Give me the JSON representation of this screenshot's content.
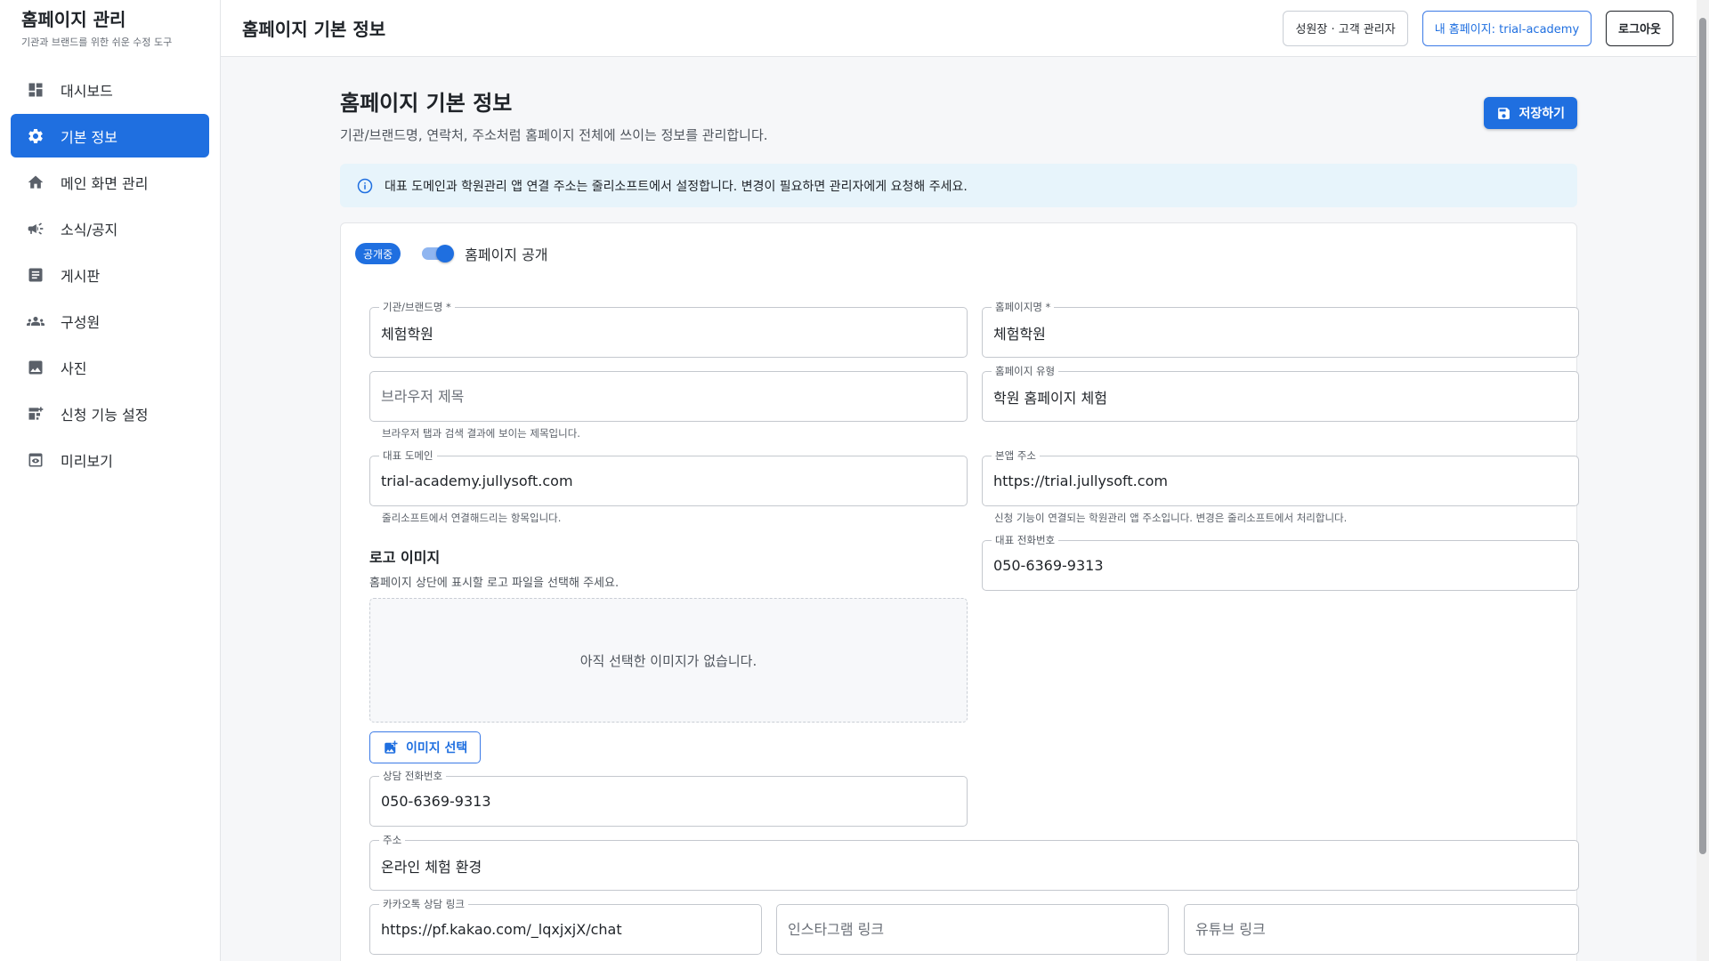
{
  "app": {
    "title": "홈페이지 관리",
    "subtitle": "기관과 브랜드를 위한 쉬운 수정 도구"
  },
  "sidebar": {
    "items": [
      {
        "label": "대시보드",
        "icon": "dashboard-icon"
      },
      {
        "label": "기본 정보",
        "icon": "gear-icon",
        "active": true
      },
      {
        "label": "메인 화면 관리",
        "icon": "home-icon"
      },
      {
        "label": "소식/공지",
        "icon": "megaphone-icon"
      },
      {
        "label": "게시판",
        "icon": "board-icon"
      },
      {
        "label": "구성원",
        "icon": "group-icon"
      },
      {
        "label": "사진",
        "icon": "image-icon"
      },
      {
        "label": "신청 기능 설정",
        "icon": "application-icon"
      },
      {
        "label": "미리보기",
        "icon": "preview-icon"
      }
    ]
  },
  "header": {
    "title": "홈페이지 기본 정보",
    "user_label": "성원장 · 고객 관리자",
    "site_label": "내 홈페이지: trial-academy",
    "logout_label": "로그아웃"
  },
  "page": {
    "title": "홈페이지 기본 정보",
    "description": "기관/브랜드명, 연락처, 주소처럼 홈페이지 전체에 쓰이는 정보를 관리합니다.",
    "save_label": "저장하기",
    "info": "대표 도메인과 학원관리 앱 연결 주소는 줄리소프트에서 설정합니다. 변경이 필요하면 관리자에게 요청해 주세요."
  },
  "publish": {
    "chip": "공개중",
    "toggle_label": "홈페이지 공개",
    "enabled": true
  },
  "form": {
    "brand_name": {
      "label": "기관/브랜드명 *",
      "value": "체험학원"
    },
    "site_name": {
      "label": "홈페이지명 *",
      "value": "체험학원"
    },
    "browser_title": {
      "placeholder": "브라우저 제목",
      "value": "",
      "helper": "브라우저 탭과 검색 결과에 보이는 제목입니다."
    },
    "site_type": {
      "label": "홈페이지 유형",
      "value": "학원 홈페이지 체험"
    },
    "domain": {
      "label": "대표 도메인",
      "value": "trial-academy.jullysoft.com",
      "helper": "줄리소프트에서 연결해드리는 항목입니다."
    },
    "app_url": {
      "label": "본앱 주소",
      "value": "https://trial.jullysoft.com",
      "helper": "신청 기능이 연결되는 학원관리 앱 주소입니다. 변경은 줄리소프트에서 처리합니다."
    },
    "phone": {
      "label": "대표 전화번호",
      "value": "050-6369-9313"
    },
    "logo": {
      "title": "로고 이미지",
      "description": "홈페이지 상단에 표시할 로고 파일을 선택해 주세요.",
      "empty": "아직 선택한 이미지가 없습니다.",
      "button": "이미지 선택"
    },
    "consult_phone": {
      "label": "상담 전화번호",
      "value": "050-6369-9313"
    },
    "address": {
      "label": "주소",
      "value": "온라인 체험 환경"
    },
    "kakao": {
      "label": "카카오톡 상담 링크",
      "value": "https://pf.kakao.com/_lqxjxjX/chat"
    },
    "instagram": {
      "placeholder": "인스타그램 링크",
      "value": ""
    },
    "youtube": {
      "placeholder": "유튜브 링크",
      "value": ""
    }
  },
  "colors": {
    "primary": "#1f6fe0",
    "info_bg": "#e7f4fb"
  }
}
